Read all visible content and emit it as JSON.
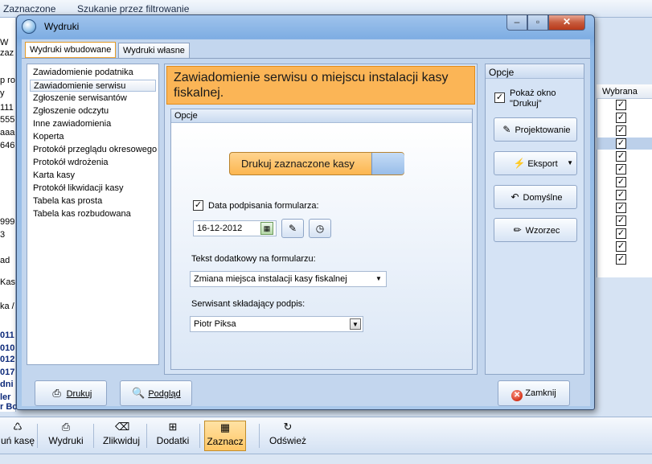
{
  "background": {
    "topbar": {
      "left_label": "Zaznaczone",
      "right_label": "Szukanie przez filtrowanie"
    },
    "left_fragments": [
      "W",
      "zaz",
      "p ro",
      "y",
      "111",
      "555",
      "aaa",
      "646",
      "999",
      "3",
      "ad",
      "Kas",
      "ka /",
      "011",
      "010",
      "012",
      "017",
      "dni",
      "ler",
      "r Bo"
    ],
    "right_column": {
      "header": "Wybrana",
      "checks": [
        "✓",
        "✓",
        "✓",
        "✓",
        "✓",
        "✓",
        "✓",
        "✓",
        "✓",
        "✓",
        "✓",
        "✓",
        "✓"
      ]
    },
    "toolbar": [
      {
        "label": "uń kasę",
        "icon": "recycle-icon"
      },
      {
        "label": "Wydruki",
        "icon": "printer-icon"
      },
      {
        "label": "Zlikwiduj",
        "icon": "liquidate-icon"
      },
      {
        "label": "Dodatki",
        "icon": "addons-icon"
      },
      {
        "label": "Zaznacz",
        "icon": "select-icon"
      },
      {
        "label": "Odśwież",
        "icon": "refresh-icon"
      }
    ]
  },
  "dialog": {
    "title": "Wydruki",
    "caption": {
      "close": "✕"
    },
    "tabs": [
      {
        "label": "Wydruki wbudowane",
        "active": true
      },
      {
        "label": "Wydruki własne",
        "active": false
      }
    ],
    "reports": [
      "Zawiadomienie podatnika",
      "Zawiadomienie serwisu",
      "Zgłoszenie serwisantów",
      "Zgłoszenie odczytu",
      "Inne zawiadomienia",
      "Koperta",
      "Protokół przeglądu okresowego",
      "Protokół wdrożenia",
      "Karta kasy",
      "Protokół likwidacji kasy",
      "Tabela kas prosta",
      "Tabela kas rozbudowana"
    ],
    "selected_report_index": 1,
    "header_text": "Zawiadomienie serwisu o miejscu instalacji kasy fiskalnej.",
    "options": {
      "group_label": "Opcje",
      "print_selected_label": "Drukuj zaznaczone kasy",
      "signing_date_label": "Data podpisania formularza:",
      "signing_date_checked": true,
      "signing_date_value": "16-12-2012",
      "extra_text_label": "Tekst dodatkowy na formularzu:",
      "extra_text_value": "Zmiana miejsca instalacji kasy fiskalnej",
      "signer_label": "Serwisant składający podpis:",
      "signer_value": "Piotr Piksa"
    },
    "right_panel": {
      "label": "Opcje",
      "show_print_window_line1": "Pokaż okno",
      "show_print_window_line2": "\"Drukuj\"",
      "show_print_window_checked": true,
      "buttons": {
        "design": "Projektowanie",
        "export": "Eksport",
        "defaults": "Domyślne",
        "template": "Wzorzec"
      }
    },
    "bottom_buttons": {
      "print": "Drukuj",
      "preview": "Podgląd",
      "close": "Zamknij"
    }
  },
  "colors": {
    "accent_orange": "#fbb556",
    "selection_blue": "#bcd0ea",
    "frame_blue": "#7faee3"
  }
}
